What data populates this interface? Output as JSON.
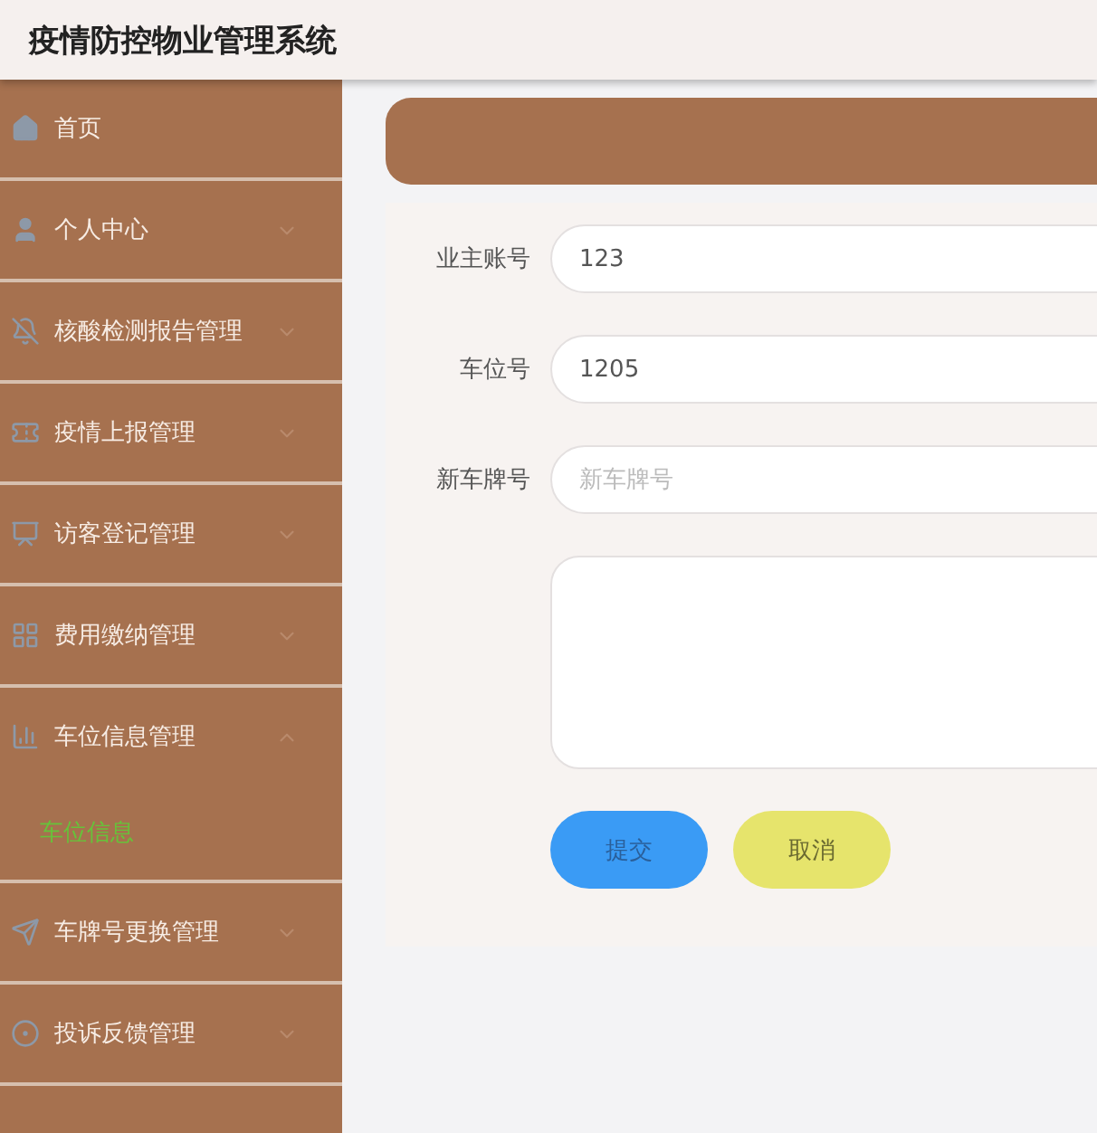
{
  "header": {
    "title": "疫情防控物业管理系统"
  },
  "sidebar": {
    "items": [
      {
        "label": "首页",
        "kind": "link"
      },
      {
        "label": "个人中心",
        "kind": "menu",
        "expanded": false
      },
      {
        "label": "核酸检测报告管理",
        "kind": "menu",
        "expanded": false
      },
      {
        "label": "疫情上报管理",
        "kind": "menu",
        "expanded": false
      },
      {
        "label": "访客登记管理",
        "kind": "menu",
        "expanded": false
      },
      {
        "label": "费用缴纳管理",
        "kind": "menu",
        "expanded": false
      },
      {
        "label": "车位信息管理",
        "kind": "menu",
        "expanded": true,
        "children": [
          {
            "label": "车位信息",
            "selected": true
          }
        ]
      },
      {
        "label": "车牌号更换管理",
        "kind": "menu",
        "expanded": false
      },
      {
        "label": "投诉反馈管理",
        "kind": "menu",
        "expanded": false
      }
    ]
  },
  "form": {
    "fields": [
      {
        "label": "业主账号",
        "kind": "input",
        "value": "123"
      },
      {
        "label": "车位号",
        "kind": "input",
        "value": "1205"
      },
      {
        "label": "新车牌号",
        "kind": "input",
        "placeholder": "新车牌号"
      },
      {
        "kind": "textarea"
      }
    ],
    "buttons": [
      {
        "label": "提交",
        "kind": "primary"
      },
      {
        "label": "取消",
        "kind": "secondary"
      }
    ]
  }
}
